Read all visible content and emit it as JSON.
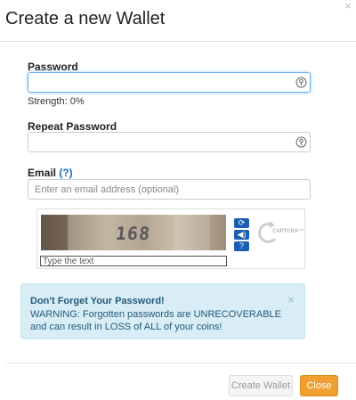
{
  "modal": {
    "title": "Create a new Wallet",
    "close_symbol": "×"
  },
  "form": {
    "password_label": "Password",
    "password_value": "",
    "strength_text": "Strength: 0%",
    "repeat_password_label": "Repeat Password",
    "repeat_password_value": "",
    "email_label": "Email",
    "email_help": "(?)",
    "email_placeholder": "Enter an email address (optional)",
    "email_value": ""
  },
  "captcha": {
    "image_text": "168",
    "input_placeholder": "Type the text",
    "logo_text": "CAPTCHA™",
    "buttons": [
      {
        "icon": "refresh-icon",
        "glyph": "⟳"
      },
      {
        "icon": "audio-icon",
        "glyph": "◀)"
      },
      {
        "icon": "help-icon",
        "glyph": "?"
      }
    ]
  },
  "alert": {
    "title": "Don't Forget Your Password!",
    "text": "WARNING: Forgotten passwords are UNRECOVERABLE and can result in LOSS of ALL of your coins!",
    "close_symbol": "×",
    "background": "#d9edf7"
  },
  "footer": {
    "create_label": "Create Wallet",
    "close_label": "Close"
  },
  "colors": {
    "accent_orange": "#f0a030",
    "focus_blue": "#66afe9",
    "link_blue": "#1f6fb5"
  }
}
